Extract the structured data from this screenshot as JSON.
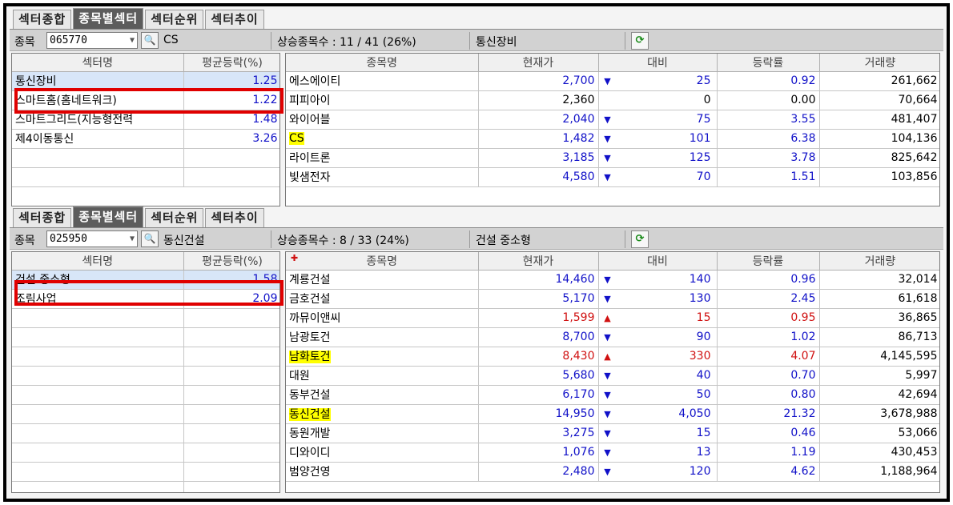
{
  "top": {
    "tabs": [
      "섹터종합",
      "종목별섹터",
      "섹터순위",
      "섹터추이"
    ],
    "active_tab": 1,
    "code_label": "종목",
    "code_value": "065770",
    "stock_name": "CS",
    "advance_label": "상승종목수 : 11 / 41 (26%)",
    "sector_name": "통신장비",
    "sector_headers": [
      "섹터명",
      "평균등락(%)"
    ],
    "sectors": [
      {
        "name": "통신장비",
        "avg": "1.25"
      },
      {
        "name": "스마트홈(홈네트워크)",
        "avg": "1.22"
      },
      {
        "name": "스마트그리드(지능형전력",
        "avg": "1.48"
      },
      {
        "name": "제4이동통신",
        "avg": "3.26"
      },
      {
        "name": "",
        "avg": ""
      },
      {
        "name": "",
        "avg": ""
      }
    ],
    "stock_headers": [
      "종목명",
      "현재가",
      "대비",
      "등락률",
      "거래량"
    ],
    "stocks": [
      {
        "name": "에스에이티",
        "price": "2,700",
        "dir": "down",
        "change": "25",
        "rate": "0.92",
        "volume": "261,662",
        "hl": false
      },
      {
        "name": "피피아이",
        "price": "2,360",
        "dir": "none",
        "change": "0",
        "rate": "0.00",
        "volume": "70,664",
        "hl": false
      },
      {
        "name": "와이어블",
        "price": "2,040",
        "dir": "down",
        "change": "75",
        "rate": "3.55",
        "volume": "481,407",
        "hl": false
      },
      {
        "name": "CS",
        "price": "1,482",
        "dir": "down",
        "change": "101",
        "rate": "6.38",
        "volume": "104,136",
        "hl": true
      },
      {
        "name": "라이트론",
        "price": "3,185",
        "dir": "down",
        "change": "125",
        "rate": "3.78",
        "volume": "825,642",
        "hl": false
      },
      {
        "name": "빛샘전자",
        "price": "4,580",
        "dir": "down",
        "change": "70",
        "rate": "1.51",
        "volume": "103,856",
        "hl": false
      }
    ]
  },
  "bottom": {
    "tabs": [
      "섹터종합",
      "종목별섹터",
      "섹터순위",
      "섹터추이"
    ],
    "active_tab": 1,
    "code_label": "종목",
    "code_value": "025950",
    "stock_name": "동신건설",
    "advance_label": "상승종목수 : 8 / 33 (24%)",
    "sector_name": "건설 중소형",
    "sector_headers": [
      "섹터명",
      "평균등락(%)"
    ],
    "sectors": [
      {
        "name": "건설 중소형",
        "avg": "1.58"
      },
      {
        "name": "조림사업",
        "avg": "2.09"
      },
      {
        "name": "",
        "avg": ""
      },
      {
        "name": "",
        "avg": ""
      },
      {
        "name": "",
        "avg": ""
      },
      {
        "name": "",
        "avg": ""
      },
      {
        "name": "",
        "avg": ""
      },
      {
        "name": "",
        "avg": ""
      },
      {
        "name": "",
        "avg": ""
      },
      {
        "name": "",
        "avg": ""
      },
      {
        "name": "",
        "avg": ""
      },
      {
        "name": "",
        "avg": ""
      }
    ],
    "stock_headers": [
      "종목명",
      "현재가",
      "대비",
      "등락률",
      "거래량"
    ],
    "stocks": [
      {
        "name": "계룡건설",
        "price": "14,460",
        "dir": "down",
        "change": "140",
        "rate": "0.96",
        "volume": "32,014",
        "hl": false
      },
      {
        "name": "금호건설",
        "price": "5,170",
        "dir": "down",
        "change": "130",
        "rate": "2.45",
        "volume": "61,618",
        "hl": false
      },
      {
        "name": "까뮤이앤씨",
        "price": "1,599",
        "dir": "up",
        "change": "15",
        "rate": "0.95",
        "volume": "36,865",
        "hl": false
      },
      {
        "name": "남광토건",
        "price": "8,700",
        "dir": "down",
        "change": "90",
        "rate": "1.02",
        "volume": "86,713",
        "hl": false
      },
      {
        "name": "남화토건",
        "price": "8,430",
        "dir": "up",
        "change": "330",
        "rate": "4.07",
        "volume": "4,145,595",
        "hl": true
      },
      {
        "name": "대원",
        "price": "5,680",
        "dir": "down",
        "change": "40",
        "rate": "0.70",
        "volume": "5,997",
        "hl": false
      },
      {
        "name": "동부건설",
        "price": "6,170",
        "dir": "down",
        "change": "50",
        "rate": "0.80",
        "volume": "42,694",
        "hl": false
      },
      {
        "name": "동신건설",
        "price": "14,950",
        "dir": "down",
        "change": "4,050",
        "rate": "21.32",
        "volume": "3,678,988",
        "hl": true
      },
      {
        "name": "동원개발",
        "price": "3,275",
        "dir": "down",
        "change": "15",
        "rate": "0.46",
        "volume": "53,066",
        "hl": false
      },
      {
        "name": "디와이디",
        "price": "1,076",
        "dir": "down",
        "change": "13",
        "rate": "1.19",
        "volume": "430,453",
        "hl": false
      },
      {
        "name": "범양건영",
        "price": "2,480",
        "dir": "down",
        "change": "120",
        "rate": "4.62",
        "volume": "1,188,964",
        "hl": false
      }
    ]
  }
}
